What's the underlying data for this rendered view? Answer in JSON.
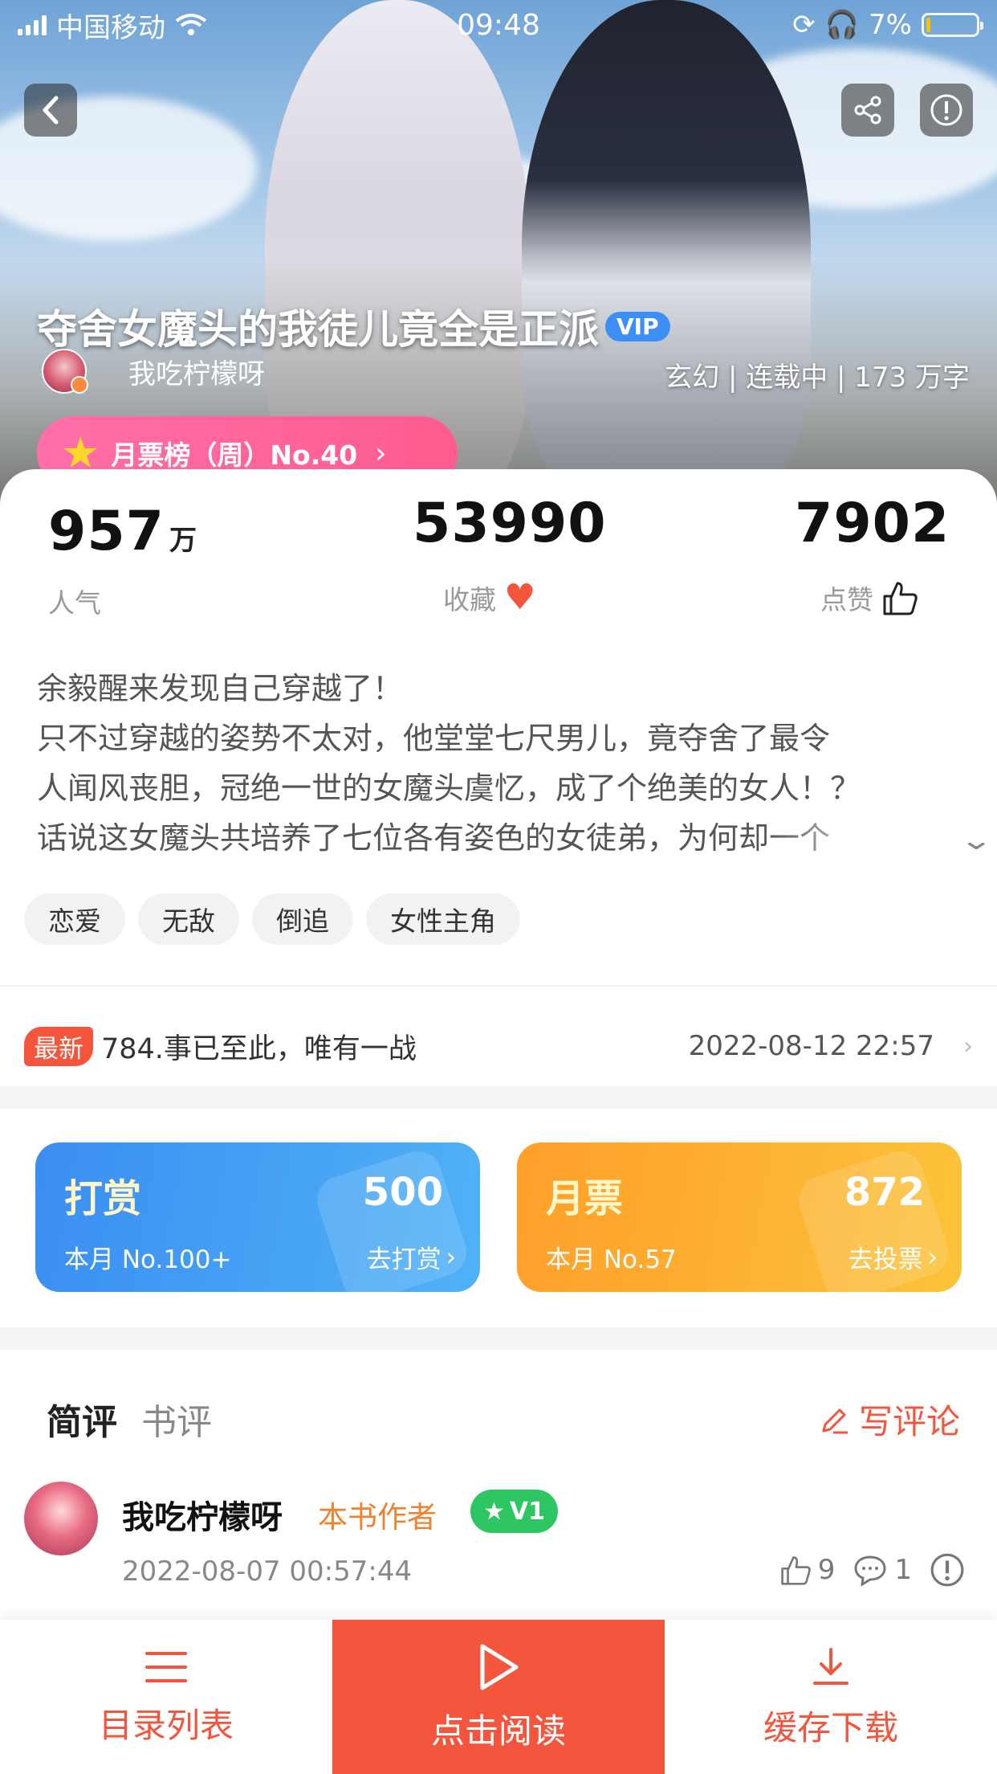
{
  "status_bar": {
    "carrier": "中国移动",
    "time": "09:48",
    "battery_text": "7%",
    "battery_level": 0.07
  },
  "hero": {
    "title": "夺舍女魔头的我徒儿竟全是正派",
    "vip_badge": "VIP",
    "author": "我吃柠檬呀",
    "meta": "玄幻 | 连载中 | 173 万字",
    "rank_label": "月票榜（周）No.40",
    "icons": {
      "back": "back-arrow-icon",
      "share": "share-icon",
      "report": "info-icon"
    }
  },
  "stats": {
    "popularity": {
      "value": "957",
      "unit": "万",
      "label": "人气"
    },
    "favorites": {
      "value": "53990",
      "label": "收藏"
    },
    "likes": {
      "value": "7902",
      "label": "点赞"
    }
  },
  "synopsis": [
    "余毅醒来发现自己穿越了！",
    "只不过穿越的姿势不太对，他堂堂七尺男儿，竟夺舍了最令",
    "人闻风丧胆，冠绝一世的女魔头虞忆，成了个绝美的女人！？",
    "话说这女魔头共培养了七位各有姿色的女徒弟，为何却一个"
  ],
  "tags": [
    "恋爱",
    "无敌",
    "倒追",
    "女性主角"
  ],
  "latest": {
    "badge": "最新",
    "chapter": "784.事已至此，唯有一战",
    "time": "2022-08-12 22:57"
  },
  "reward_cards": {
    "tip": {
      "title": "打赏",
      "count": "500",
      "rank": "本月 No.100+",
      "action": "去打赏"
    },
    "monthly": {
      "title": "月票",
      "count": "872",
      "rank": "本月 No.57",
      "action": "去投票"
    }
  },
  "reviews": {
    "tabs": [
      "简评",
      "书评"
    ],
    "write_label": "写评论",
    "items": [
      {
        "name": "我吃柠檬呀",
        "role": "本书作者",
        "level": "V1",
        "time": "2022-08-07 00:57:44",
        "likes": "9",
        "comments": "1"
      }
    ]
  },
  "bottom_bar": {
    "catalog": "目录列表",
    "read": "点击阅读",
    "download": "缓存下载"
  },
  "colors": {
    "accent": "#f4553d",
    "rank_pill": "#ff5c8f",
    "vip": "#3e8ff5",
    "tip_card": "#3b8ef1",
    "monthly_card": "#ff9f2a",
    "author_role": "#f0822f",
    "level_badge": "#2ec662"
  }
}
